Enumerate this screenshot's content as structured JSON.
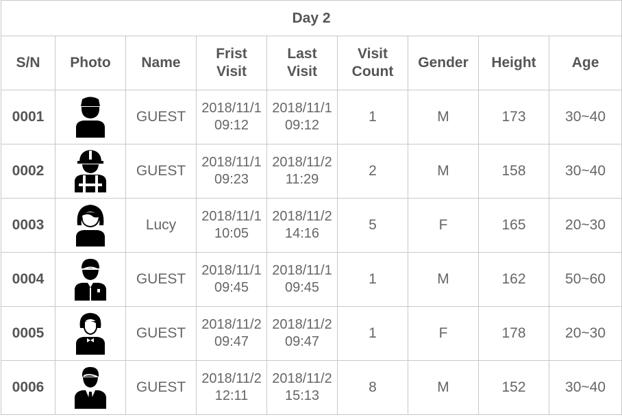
{
  "title": "Day 2",
  "headers": {
    "sn": "S/N",
    "photo": "Photo",
    "name": "Name",
    "first_visit_l1": "Frist",
    "first_visit_l2": "Visit",
    "last_visit_l1": "Last",
    "last_visit_l2": "Visit",
    "visit_count_l1": "Visit",
    "visit_count_l2": "Count",
    "gender": "Gender",
    "height": "Height",
    "age": "Age"
  },
  "rows": [
    {
      "sn": "0001",
      "icon": "worker-cap-person-icon",
      "name": "GUEST",
      "first_date": "2018/11/1",
      "first_time": "09:12",
      "last_date": "2018/11/1",
      "last_time": "09:12",
      "count": "1",
      "gender": "M",
      "height": "173",
      "age": "30~40"
    },
    {
      "sn": "0002",
      "icon": "construction-worker-icon",
      "name": "GUEST",
      "first_date": "2018/11/1",
      "first_time": "09:23",
      "last_date": "2018/11/2",
      "last_time": "11:29",
      "count": "2",
      "gender": "M",
      "height": "158",
      "age": "30~40"
    },
    {
      "sn": "0003",
      "icon": "woman-icon",
      "name": "Lucy",
      "first_date": "2018/11/1",
      "first_time": "10:05",
      "last_date": "2018/11/2",
      "last_time": "14:16",
      "count": "5",
      "gender": "F",
      "height": "165",
      "age": "20~30"
    },
    {
      "sn": "0004",
      "icon": "doctor-icon",
      "name": "GUEST",
      "first_date": "2018/11/1",
      "first_time": "09:45",
      "last_date": "2018/11/1",
      "last_time": "09:45",
      "count": "1",
      "gender": "M",
      "height": "162",
      "age": "50~60"
    },
    {
      "sn": "0005",
      "icon": "waitress-icon",
      "name": "GUEST",
      "first_date": "2018/11/2",
      "first_time": "09:47",
      "last_date": "2018/11/2",
      "last_time": "09:47",
      "count": "1",
      "gender": "F",
      "height": "178",
      "age": "20~30"
    },
    {
      "sn": "0006",
      "icon": "businessman-icon",
      "name": "GUEST",
      "first_date": "2018/11/2",
      "first_time": "12:11",
      "last_date": "2018/11/2",
      "last_time": "15:13",
      "count": "8",
      "gender": "M",
      "height": "152",
      "age": "30~40"
    }
  ]
}
